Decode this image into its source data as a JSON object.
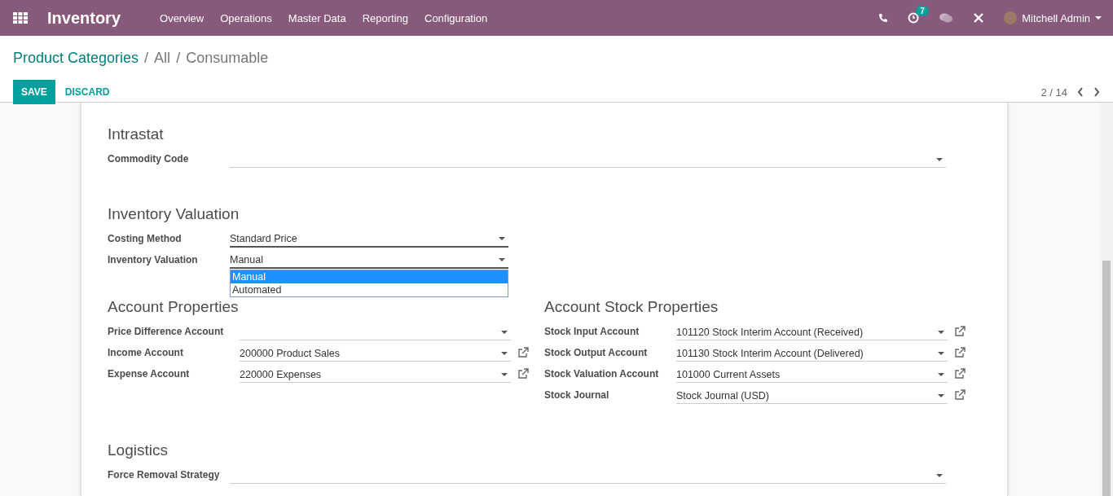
{
  "topbar": {
    "app": "Inventory",
    "menu": [
      "Overview",
      "Operations",
      "Master Data",
      "Reporting",
      "Configuration"
    ],
    "activity_count": "7",
    "user": "Mitchell Admin"
  },
  "breadcrumb": {
    "items": [
      "Product Categories",
      "All",
      "Consumable"
    ],
    "separator": "/"
  },
  "buttons": {
    "save": "SAVE",
    "discard": "DISCARD"
  },
  "pager": "2 / 14",
  "sections": [
    {
      "kind": "full",
      "title": "Intrastat",
      "fields": [
        {
          "label": "Commodity Code",
          "focused": false,
          "open_link": false
        }
      ]
    },
    {
      "kind": "half",
      "title": "Inventory Valuation",
      "fields": [
        {
          "label": "Costing Method",
          "value": "Standard Price",
          "focused": true,
          "open_link": false
        },
        {
          "label": "Inventory Valuation",
          "value": "Manual",
          "focused": true,
          "open_link": false,
          "dropdown": [
            {
              "label": "Manual",
              "selected": true
            },
            {
              "label": "Automated",
              "selected": false
            }
          ]
        }
      ]
    },
    {
      "kind": "columns",
      "columns": [
        {
          "title": "Account Properties",
          "fields": [
            {
              "label": "Price Difference Account",
              "focused": false,
              "open_link": false
            },
            {
              "label": "Income Account",
              "value": "200000 Product Sales",
              "focused": false,
              "open_link": true
            },
            {
              "label": "Expense Account",
              "value": "220000 Expenses",
              "focused": false,
              "open_link": true
            }
          ]
        },
        {
          "title": "Account Stock Properties",
          "fields": [
            {
              "label": "Stock Input Account",
              "value": "101120 Stock Interim Account (Received)",
              "focused": false,
              "open_link": true
            },
            {
              "label": "Stock Output Account",
              "value": "101130 Stock Interim Account (Delivered)",
              "focused": false,
              "open_link": true
            },
            {
              "label": "Stock Valuation Account",
              "value": "101000 Current Assets",
              "focused": false,
              "open_link": true
            },
            {
              "label": "Stock Journal",
              "value": "Stock Journal (USD)",
              "focused": false,
              "open_link": true
            }
          ]
        }
      ]
    },
    {
      "kind": "full",
      "title": "Logistics",
      "fields": [
        {
          "label": "Force Removal Strategy",
          "focused": false,
          "open_link": false
        }
      ]
    }
  ]
}
